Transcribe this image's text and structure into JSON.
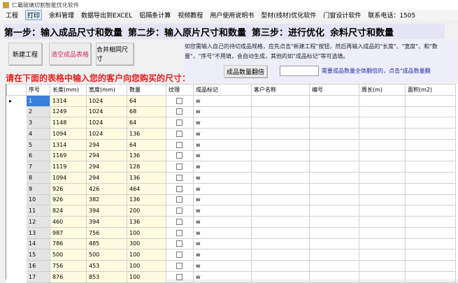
{
  "app": {
    "title": "仁霸玻璃切割智能优化软件"
  },
  "menu": [
    "工程",
    "打印",
    "余料管理",
    "数据导出到EXCEL",
    "铝隔条计算",
    "视频教程",
    "用户使用说明书",
    "型材(线材)优化软件",
    "门窗设计软件",
    "联系电话：1505"
  ],
  "steps": [
    "第一步：输入成品尺寸和数量",
    "第二步：输入原片尺寸和数量",
    "第三步：进行优化",
    "余料尺寸和数量"
  ],
  "buttons": {
    "new_project": "新建工程",
    "clear_table": "清空成品表格",
    "merge_same": "合并相同尺寸",
    "batch_qty": "成品数量翻倍"
  },
  "description": "如您需输入自己的待切成品规格，应先点击\"新建工程\"按钮，然后再输入成品的\"长度\"、\"宽度\"、和\"数量\"，\"序号\"不用填，会自动生成，其他的如\"成品标记\"等可选填。",
  "red_prompt": "请在下面的表格中输入您的客户向您购买的尺寸：",
  "multiplier_value": "",
  "hint": "需要成品数量全体翻倍的，点击\"成品数量翻",
  "table": {
    "headers": [
      "序号",
      "长度(mm)",
      "宽度(mm)",
      "数量",
      "纹理",
      "成品标记",
      "客户名称",
      "编号",
      "周长(m)",
      "面积(m2)"
    ],
    "rows": [
      [
        "1",
        "1314",
        "1024",
        "64",
        false,
        "w"
      ],
      [
        "2",
        "1249",
        "1024",
        "68",
        false,
        "w"
      ],
      [
        "3",
        "1148",
        "1024",
        "64",
        false,
        "w"
      ],
      [
        "4",
        "1094",
        "1024",
        "136",
        false,
        "w"
      ],
      [
        "5",
        "1314",
        "294",
        "64",
        false,
        "w"
      ],
      [
        "6",
        "1169",
        "294",
        "136",
        false,
        "w"
      ],
      [
        "7",
        "1119",
        "294",
        "128",
        false,
        "w"
      ],
      [
        "8",
        "1094",
        "294",
        "136",
        false,
        "w"
      ],
      [
        "9",
        "926",
        "426",
        "464",
        false,
        "w"
      ],
      [
        "10",
        "926",
        "382",
        "136",
        false,
        "w"
      ],
      [
        "11",
        "824",
        "394",
        "200",
        false,
        "w"
      ],
      [
        "12",
        "460",
        "394",
        "136",
        false,
        "w"
      ],
      [
        "13",
        "987",
        "756",
        "100",
        false,
        "w"
      ],
      [
        "14",
        "786",
        "485",
        "300",
        false,
        "w"
      ],
      [
        "15",
        "500",
        "500",
        "100",
        false,
        "w"
      ],
      [
        "16",
        "756",
        "453",
        "100",
        false,
        "w"
      ],
      [
        "17",
        "876",
        "853",
        "100",
        false,
        "w"
      ]
    ]
  }
}
